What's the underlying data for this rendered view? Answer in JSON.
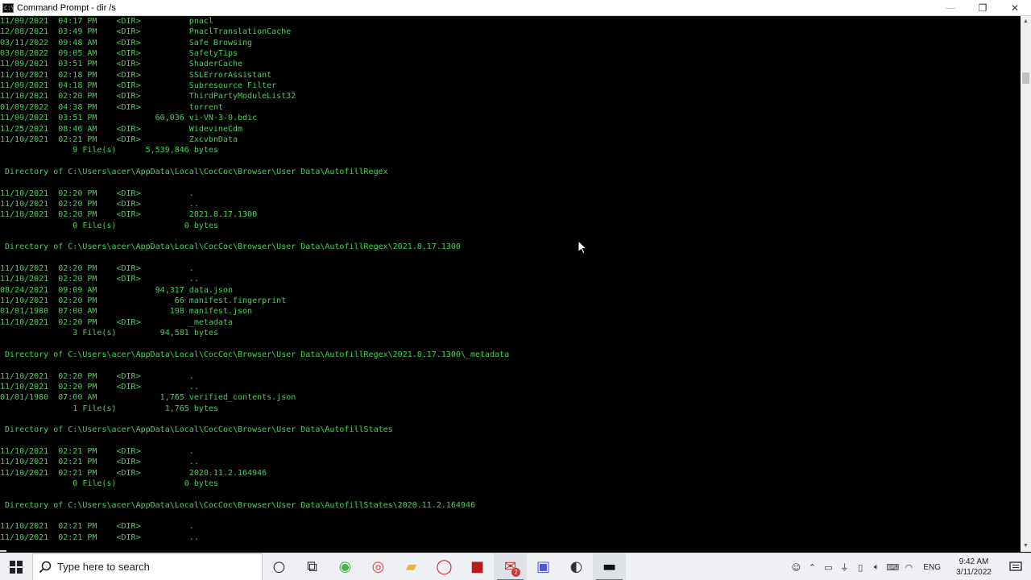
{
  "window": {
    "title": "Command Prompt - dir /s",
    "icon": "cmd-icon",
    "controls": {
      "minimize": "—",
      "maximize": "❐",
      "close": "✕"
    }
  },
  "console": {
    "text_color": "#42d552",
    "lines": [
      "11/09/2021  04:17 PM    <DIR>          pnacl",
      "12/08/2021  03:49 PM    <DIR>          PnaclTranslationCache",
      "03/11/2022  09:48 AM    <DIR>          Safe Browsing",
      "03/08/2022  09:05 AM    <DIR>          SafetyTips",
      "11/09/2021  03:51 PM    <DIR>          ShaderCache",
      "11/10/2021  02:18 PM    <DIR>          SSLErrorAssistant",
      "11/09/2021  04:18 PM    <DIR>          Subresource Filter",
      "11/10/2021  02:20 PM    <DIR>          ThirdPartyModuleList32",
      "01/09/2022  04:38 PM    <DIR>          torrent",
      "11/09/2021  03:51 PM            60,036 vi-VN-3-0.bdic",
      "11/25/2021  08:46 AM    <DIR>          WidevineCdm",
      "11/10/2021  02:21 PM    <DIR>          ZxcvbnData",
      "               9 File(s)      5,539,846 bytes",
      "",
      " Directory of C:\\Users\\acer\\AppData\\Local\\CocCoc\\Browser\\User Data\\AutofillRegex",
      "",
      "11/10/2021  02:20 PM    <DIR>          .",
      "11/10/2021  02:20 PM    <DIR>          ..",
      "11/10/2021  02:20 PM    <DIR>          2021.8.17.1300",
      "               0 File(s)              0 bytes",
      "",
      " Directory of C:\\Users\\acer\\AppData\\Local\\CocCoc\\Browser\\User Data\\AutofillRegex\\2021.8.17.1300",
      "",
      "11/10/2021  02:20 PM    <DIR>          .",
      "11/10/2021  02:20 PM    <DIR>          ..",
      "08/24/2021  09:09 AM            94,317 data.json",
      "11/10/2021  02:20 PM                66 manifest.fingerprint",
      "01/01/1980  07:00 AM               198 manifest.json",
      "11/10/2021  02:20 PM    <DIR>          _metadata",
      "               3 File(s)         94,581 bytes",
      "",
      " Directory of C:\\Users\\acer\\AppData\\Local\\CocCoc\\Browser\\User Data\\AutofillRegex\\2021.8.17.1300\\_metadata",
      "",
      "11/10/2021  02:20 PM    <DIR>          .",
      "11/10/2021  02:20 PM    <DIR>          ..",
      "01/01/1980  07:00 AM             1,765 verified_contents.json",
      "               1 File(s)          1,765 bytes",
      "",
      " Directory of C:\\Users\\acer\\AppData\\Local\\CocCoc\\Browser\\User Data\\AutofillStates",
      "",
      "11/10/2021  02:21 PM    <DIR>          .",
      "11/10/2021  02:21 PM    <DIR>          ..",
      "11/10/2021  02:21 PM    <DIR>          2020.11.2.164946",
      "               0 File(s)              0 bytes",
      "",
      " Directory of C:\\Users\\acer\\AppData\\Local\\CocCoc\\Browser\\User Data\\AutofillStates\\2020.11.2.164946",
      "",
      "11/10/2021  02:21 PM    <DIR>          .",
      "11/10/2021  02:21 PM    <DIR>          .."
    ]
  },
  "taskbar": {
    "search_placeholder": "Type here to search",
    "apps": [
      {
        "name": "cortana-icon",
        "glyph": "○",
        "color": "#222"
      },
      {
        "name": "task-view-icon",
        "glyph": "⧉",
        "color": "#222"
      },
      {
        "name": "coccoc-browser-icon",
        "glyph": "◉",
        "color": "#4caf50"
      },
      {
        "name": "chrome-icon",
        "glyph": "◎",
        "color": "#db4437"
      },
      {
        "name": "file-explorer-icon",
        "glyph": "▰",
        "color": "#e8b730"
      },
      {
        "name": "opera-icon",
        "glyph": "◯",
        "color": "#e0202c"
      },
      {
        "name": "red-app-icon",
        "glyph": "■",
        "color": "#b71c1c"
      },
      {
        "name": "mail-app-icon",
        "glyph": "✉",
        "color": "#c62828",
        "badge": "2",
        "active": true
      },
      {
        "name": "teams-icon",
        "glyph": "▣",
        "color": "#5059c9"
      },
      {
        "name": "obs-icon",
        "glyph": "◐",
        "color": "#333333"
      },
      {
        "name": "command-prompt-icon",
        "glyph": "▬",
        "color": "#111111",
        "active": true
      }
    ],
    "tray": {
      "language": "ENG",
      "time": "9:42 AM",
      "date": "3/11/2022"
    }
  }
}
